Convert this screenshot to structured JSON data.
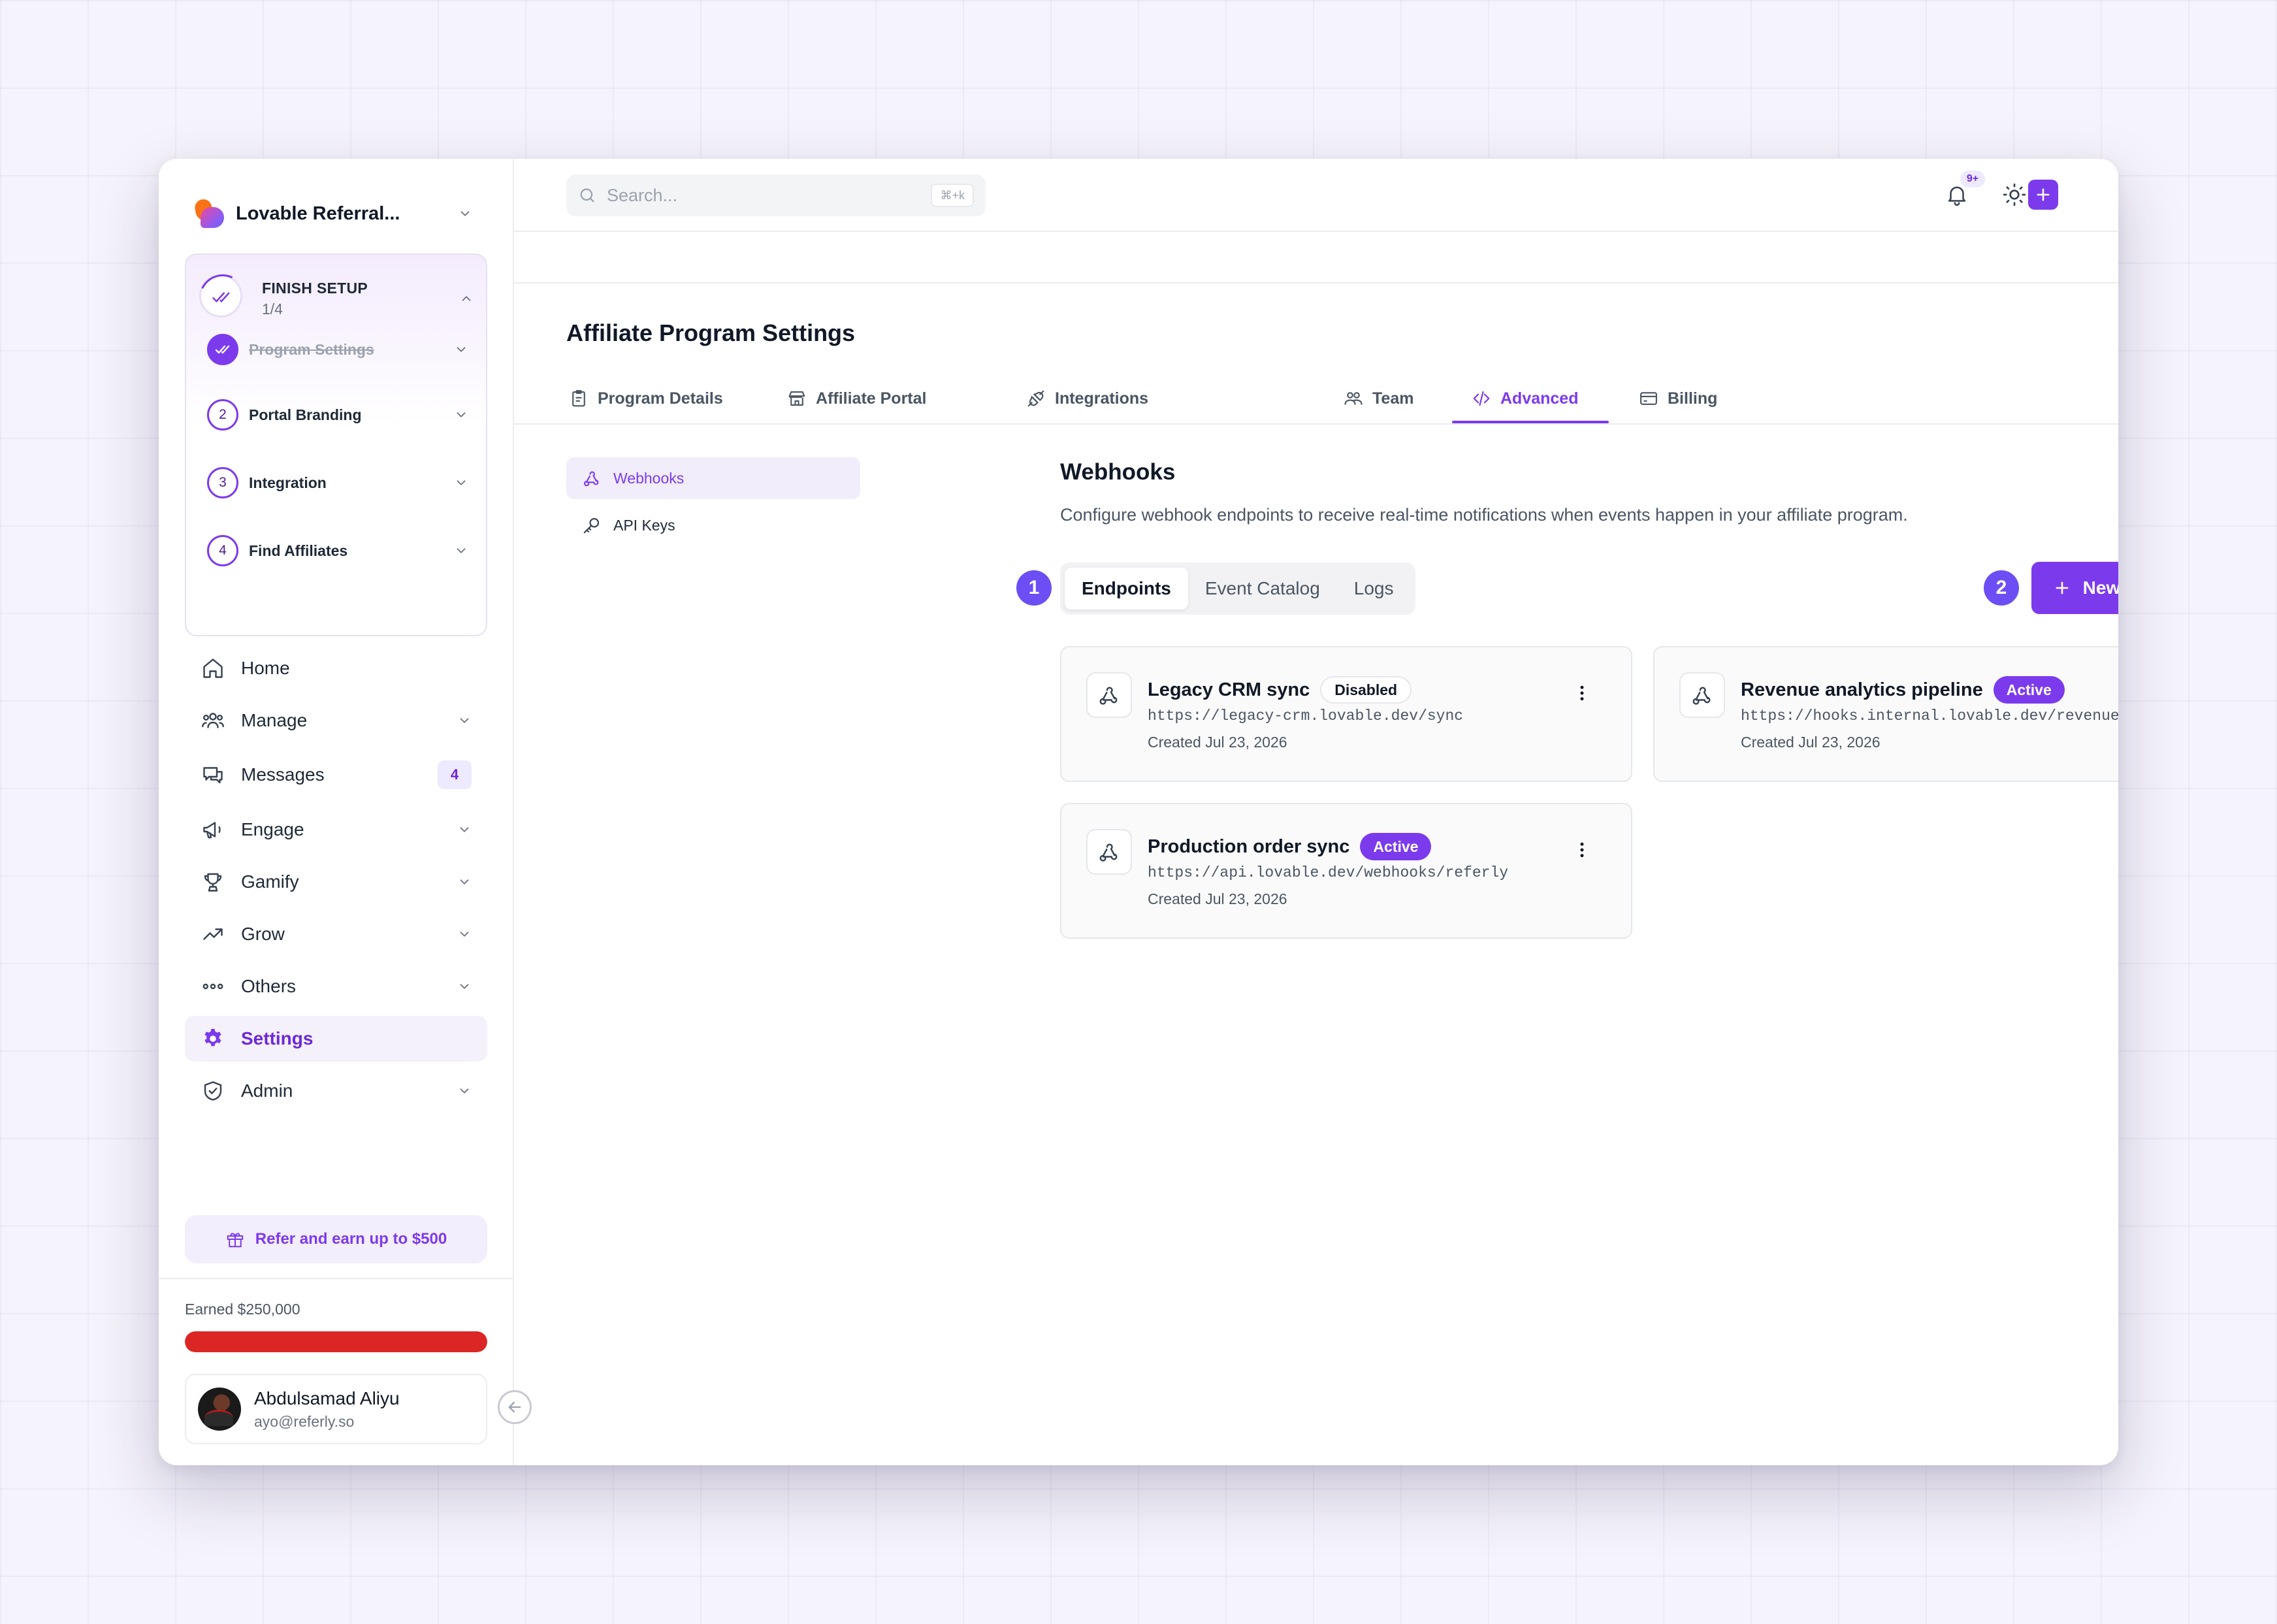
{
  "sidebar": {
    "org_name": "Lovable Referral...",
    "setup": {
      "title": "FINISH SETUP",
      "progress": "1/4",
      "steps": [
        {
          "num": "",
          "label": "Program Settings",
          "done": true
        },
        {
          "num": "2",
          "label": "Portal Branding",
          "done": false
        },
        {
          "num": "3",
          "label": "Integration",
          "done": false
        },
        {
          "num": "4",
          "label": "Find Affiliates",
          "done": false
        }
      ]
    },
    "nav": [
      {
        "label": "Home",
        "icon": "home-icon"
      },
      {
        "label": "Manage",
        "icon": "users-icon"
      },
      {
        "label": "Messages",
        "icon": "chat-icon",
        "count": "4"
      },
      {
        "label": "Engage",
        "icon": "megaphone-icon"
      },
      {
        "label": "Gamify",
        "icon": "trophy-icon"
      },
      {
        "label": "Grow",
        "icon": "trending-up-icon"
      },
      {
        "label": "Others",
        "icon": "dots-icon"
      },
      {
        "label": "Settings",
        "icon": "gear-icon",
        "active": true
      },
      {
        "label": "Admin",
        "icon": "shield-icon"
      }
    ],
    "refer_label": "Refer and earn up to $500",
    "earned_label": "Earned $250,000",
    "earned_progress": 1.0,
    "user": {
      "name": "Abdulsamad Aliyu",
      "email": "ayo@referly.so"
    }
  },
  "topbar": {
    "search_placeholder": "Search...",
    "search_shortcut": "⌘+k",
    "notifications_badge": "9+"
  },
  "page": {
    "title": "Affiliate Program Settings",
    "tabs": [
      {
        "label": "Program Details",
        "icon": "clipboard-icon"
      },
      {
        "label": "Affiliate Portal",
        "icon": "store-icon"
      },
      {
        "label": "Integrations",
        "icon": "plug-icon"
      },
      {
        "label": "Team",
        "icon": "team-icon"
      },
      {
        "label": "Advanced",
        "icon": "code-icon",
        "active": true
      },
      {
        "label": "Billing",
        "icon": "credit-card-icon"
      }
    ],
    "subnav": [
      {
        "label": "Webhooks",
        "icon": "webhook-icon",
        "active": true
      },
      {
        "label": "API Keys",
        "icon": "key-icon"
      }
    ]
  },
  "webhooks": {
    "title": "Webhooks",
    "description": "Configure webhook endpoints to receive real-time notifications when events happen in your affiliate program.",
    "marker_1": "1",
    "marker_2": "2",
    "segments": [
      "Endpoints",
      "Event Catalog",
      "Logs"
    ],
    "new_endpoint_label": "New Endpoint",
    "endpoints": [
      {
        "name": "Legacy CRM sync",
        "status": "Disabled",
        "url": "https://legacy-crm.lovable.dev/sync",
        "created": "Created Jul 23, 2026"
      },
      {
        "name": "Revenue analytics pipeline",
        "status": "Active",
        "url": "https://hooks.internal.lovable.dev/revenue-…",
        "created": "Created Jul 23, 2026"
      },
      {
        "name": "Production order sync",
        "status": "Active",
        "url": "https://api.lovable.dev/webhooks/referly",
        "created": "Created Jul 23, 2026"
      }
    ]
  },
  "colors": {
    "accent": "#7c3aed",
    "progress": "#dc2626",
    "marker": "#6d4ef5"
  }
}
